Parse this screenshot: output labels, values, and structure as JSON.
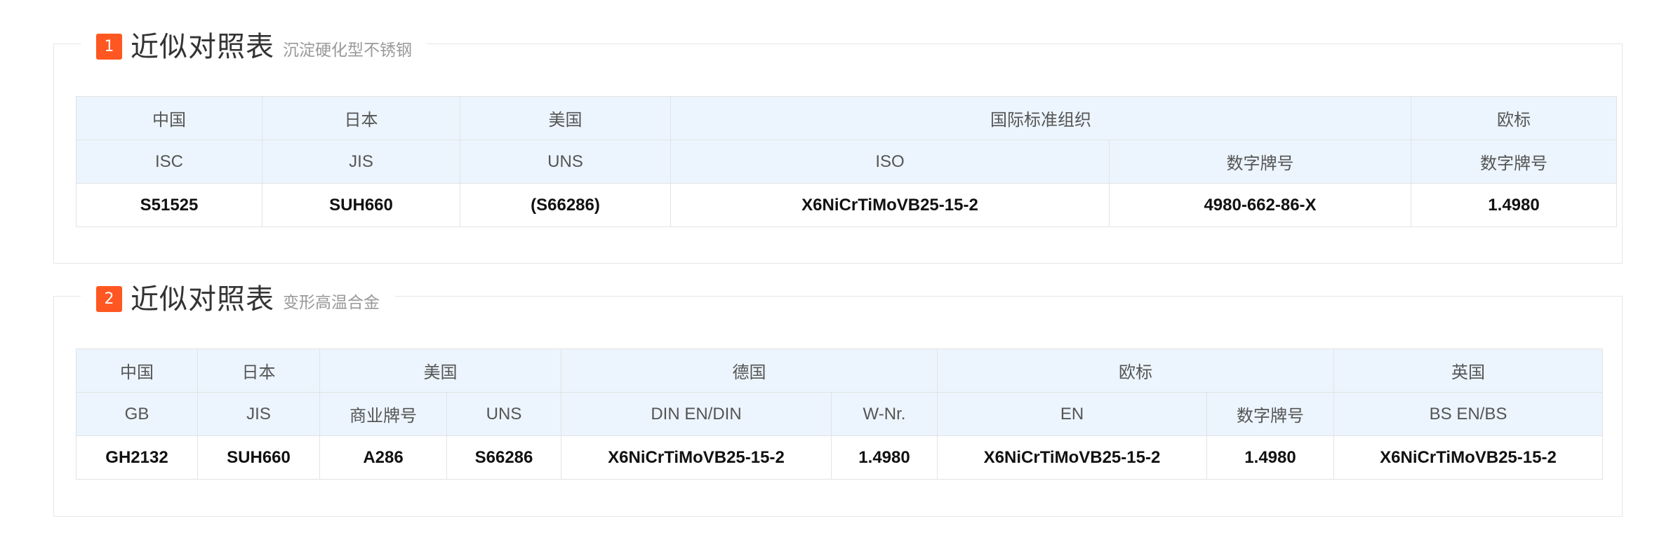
{
  "section1": {
    "badge": "1",
    "title": "近似对照表",
    "subtitle": "沉淀硬化型不锈钢",
    "header_row1": [
      "中国",
      "日本",
      "美国",
      "国际标准组织",
      "欧标"
    ],
    "header_row2": [
      "ISC",
      "JIS",
      "UNS",
      "ISO",
      "数字牌号",
      "数字牌号"
    ],
    "values": [
      "S51525",
      "SUH660",
      "(S66286)",
      "X6NiCrTiMoVB25-15-2",
      "4980-662-86-X",
      "1.4980"
    ]
  },
  "section2": {
    "badge": "2",
    "title": "近似对照表",
    "subtitle": "变形高温合金",
    "header_row1": [
      "中国",
      "日本",
      "美国",
      "德国",
      "欧标",
      "英国"
    ],
    "header_row2": [
      "GB",
      "JIS",
      "商业牌号",
      "UNS",
      "DIN EN/DIN",
      "W-Nr.",
      "EN",
      "数字牌号",
      "BS EN/BS"
    ],
    "values": [
      "GH2132",
      "SUH660",
      "A286",
      "S66286",
      "X6NiCrTiMoVB25-15-2",
      "1.4980",
      "X6NiCrTiMoVB25-15-2",
      "1.4980",
      "X6NiCrTiMoVB25-15-2"
    ]
  },
  "colors": {
    "badge_bg": "#ff5722",
    "header_bg": "#ecf5fd",
    "border": "#e3e3e3"
  }
}
